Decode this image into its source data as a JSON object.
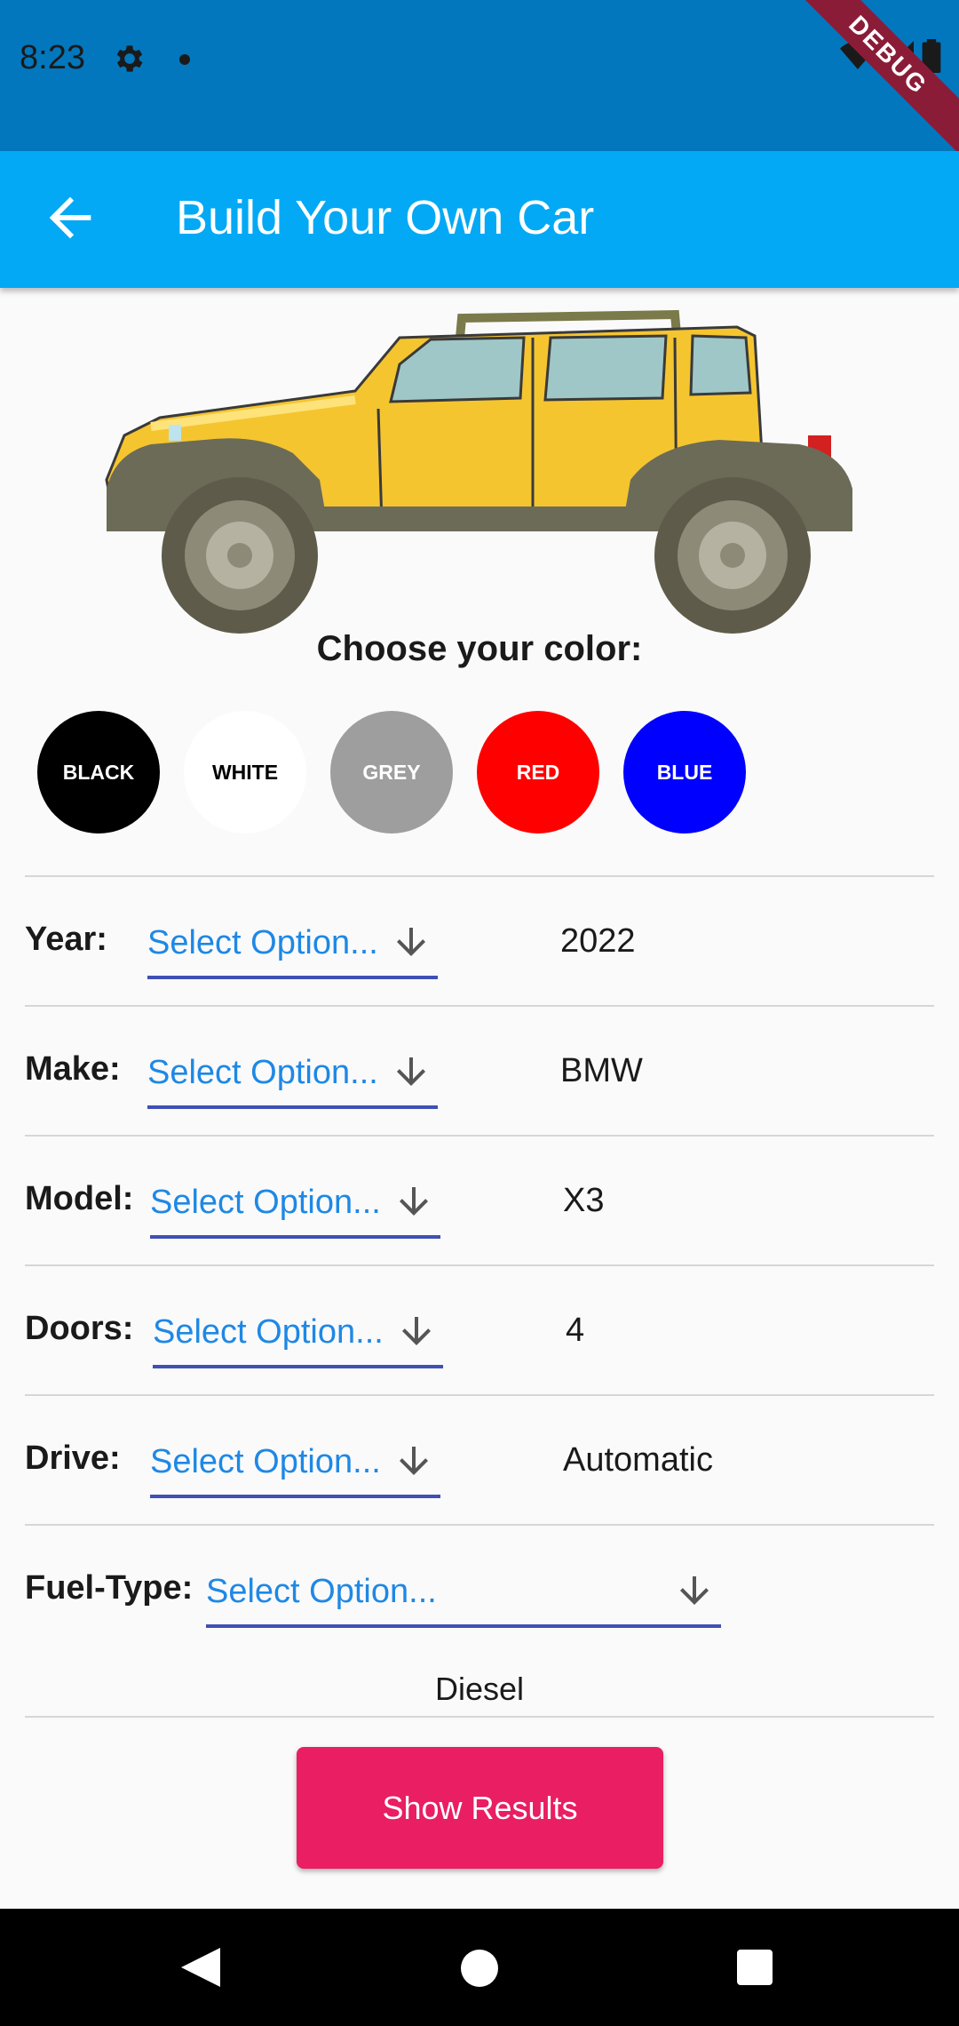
{
  "status_bar": {
    "time": "8:23"
  },
  "debug_banner": "DEBUG",
  "app_bar": {
    "title": "Build Your Own Car"
  },
  "color_section": {
    "heading": "Choose your color:",
    "colors": [
      {
        "label": "BLACK",
        "bg": "#000000",
        "fg": "#ffffff"
      },
      {
        "label": "WHITE",
        "bg": "#ffffff",
        "fg": "#000000"
      },
      {
        "label": "GREY",
        "bg": "#9e9e9e",
        "fg": "#ffffff"
      },
      {
        "label": "RED",
        "bg": "#ff0000",
        "fg": "#ffffff"
      },
      {
        "label": "BLUE",
        "bg": "#0000ff",
        "fg": "#ffffff"
      }
    ]
  },
  "fields": [
    {
      "label": "Year:",
      "placeholder": "Select Option...",
      "value": "2022"
    },
    {
      "label": "Make:",
      "placeholder": "Select Option...",
      "value": "BMW"
    },
    {
      "label": "Model:",
      "placeholder": "Select Option...",
      "value": "X3"
    },
    {
      "label": "Doors:",
      "placeholder": "Select Option...",
      "value": "4"
    },
    {
      "label": "Drive:",
      "placeholder": "Select Option...",
      "value": "Automatic"
    },
    {
      "label": "Fuel-Type:",
      "placeholder": "Select Option...",
      "value": "Diesel"
    }
  ],
  "show_results": {
    "label": "Show Results"
  },
  "theme": {
    "app_bar": "#03a9f4",
    "status_bar": "#0277bd",
    "accent": "#e91e63",
    "dropdown_text": "#1e88e5",
    "dropdown_underline": "#3f51b5"
  }
}
